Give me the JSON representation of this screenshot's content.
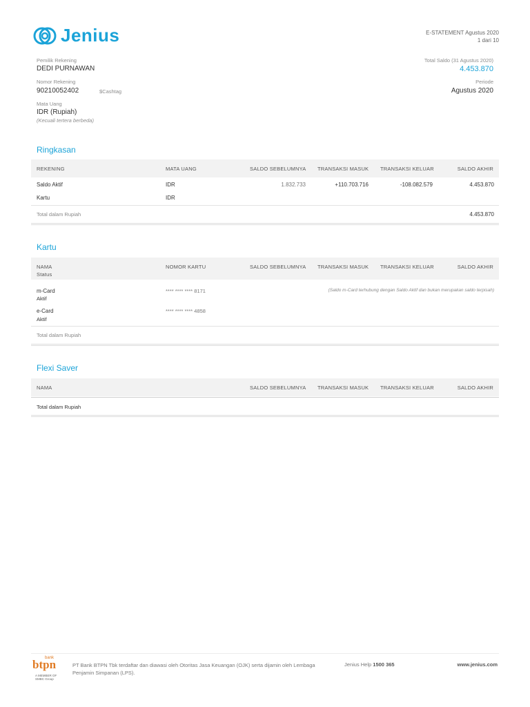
{
  "brand": {
    "name": "Jenius",
    "color": "#1ba3d8"
  },
  "statement": {
    "title": "E-STATEMENT Agustus 2020",
    "page": "1 dari 10"
  },
  "account": {
    "owner_label": "Pemilik Rekening",
    "owner": "DEDI PURNAWAN",
    "number_label": "Nomor Rekening",
    "number": "90210052402",
    "cashtag": "$Cashtag",
    "currency_label": "Mata Uang",
    "currency": "IDR (Rupiah)",
    "currency_note": "(Kecuali tertera berbeda)",
    "total_label": "Total Saldo (31 Agustus 2020)",
    "total": "4.453.870",
    "period_label": "Periode",
    "period": "Agustus 2020"
  },
  "ringkasan": {
    "title": "Ringkasan",
    "headers": [
      "REKENING",
      "MATA UANG",
      "SALDO SEBELUMNYA",
      "TRANSAKSI MASUK",
      "TRANSAKSI KELUAR",
      "SALDO AKHIR"
    ],
    "rows": [
      {
        "name": "Saldo Aktif",
        "currency": "IDR",
        "prev": "1.832.733",
        "in": "+110.703.716",
        "out": "-108.082.579",
        "end": "4.453.870"
      },
      {
        "name": "Kartu",
        "currency": "IDR",
        "prev": "",
        "in": "",
        "out": "",
        "end": ""
      }
    ],
    "total_label": "Total dalam Rupiah",
    "total": "4.453.870"
  },
  "kartu": {
    "title": "Kartu",
    "headers": [
      "NAMA",
      "Status",
      "NOMOR KARTU",
      "SALDO SEBELUMNYA",
      "TRANSAKSI MASUK",
      "TRANSAKSI KELUAR",
      "SALDO AKHIR"
    ],
    "rows": [
      {
        "name": "m-Card",
        "status": "Aktif",
        "number": "**** **** **** 8171"
      },
      {
        "name": "e-Card",
        "status": "Aktif",
        "number": "**** **** **** 4858"
      }
    ],
    "note": "(Saldo m-Card terhubung dengan Saldo Aktif dan bukan merupakan saldo terpisah)",
    "total_label": "Total dalam Rupiah"
  },
  "flexi": {
    "title": "Flexi Saver",
    "headers": [
      "NAMA",
      "SALDO SEBELUMNYA",
      "TRANSAKSI MASUK",
      "TRANSAKSI KELUAR",
      "SALDO AKHIR"
    ],
    "total_label": "Total dalam Rupiah"
  },
  "footer": {
    "bank_small": "bank",
    "bank_logo": "btpn",
    "bank_sub": "A MEMBER OF SMBC Group",
    "legal": "PT Bank BTPN Tbk terdaftar dan diawasi oleh Otoritas Jasa Keuangan (OJK) serta dijamin oleh Lembaga Penjamin Simpanan (LPS).",
    "help_label": "Jenius Help",
    "help_number": "1500 365",
    "website": "www.jenius.com"
  }
}
